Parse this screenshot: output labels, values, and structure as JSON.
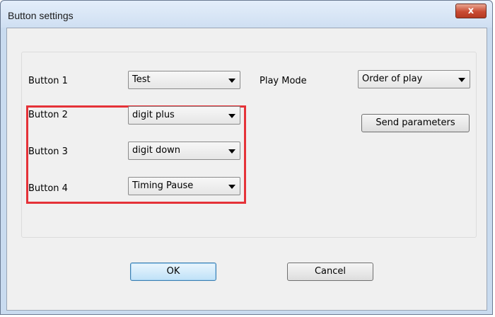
{
  "window": {
    "title": "Button settings",
    "close_glyph": "x"
  },
  "rows": [
    {
      "label": "Button 1",
      "value": "Test"
    },
    {
      "label": "Button 2",
      "value": "digit plus"
    },
    {
      "label": "Button 3",
      "value": "digit down"
    },
    {
      "label": "Button 4",
      "value": "Timing Pause"
    }
  ],
  "play_mode": {
    "label": "Play Mode",
    "value": "Order of play"
  },
  "buttons": {
    "send": "Send parameters",
    "ok": "OK",
    "cancel": "Cancel"
  },
  "colors": {
    "highlight": "#e53238",
    "title_bar": "#d6e4f5",
    "dialog_bg": "#f0f0f0"
  },
  "icons": {
    "close": "close-icon",
    "dropdown": "chevron-down-icon"
  }
}
